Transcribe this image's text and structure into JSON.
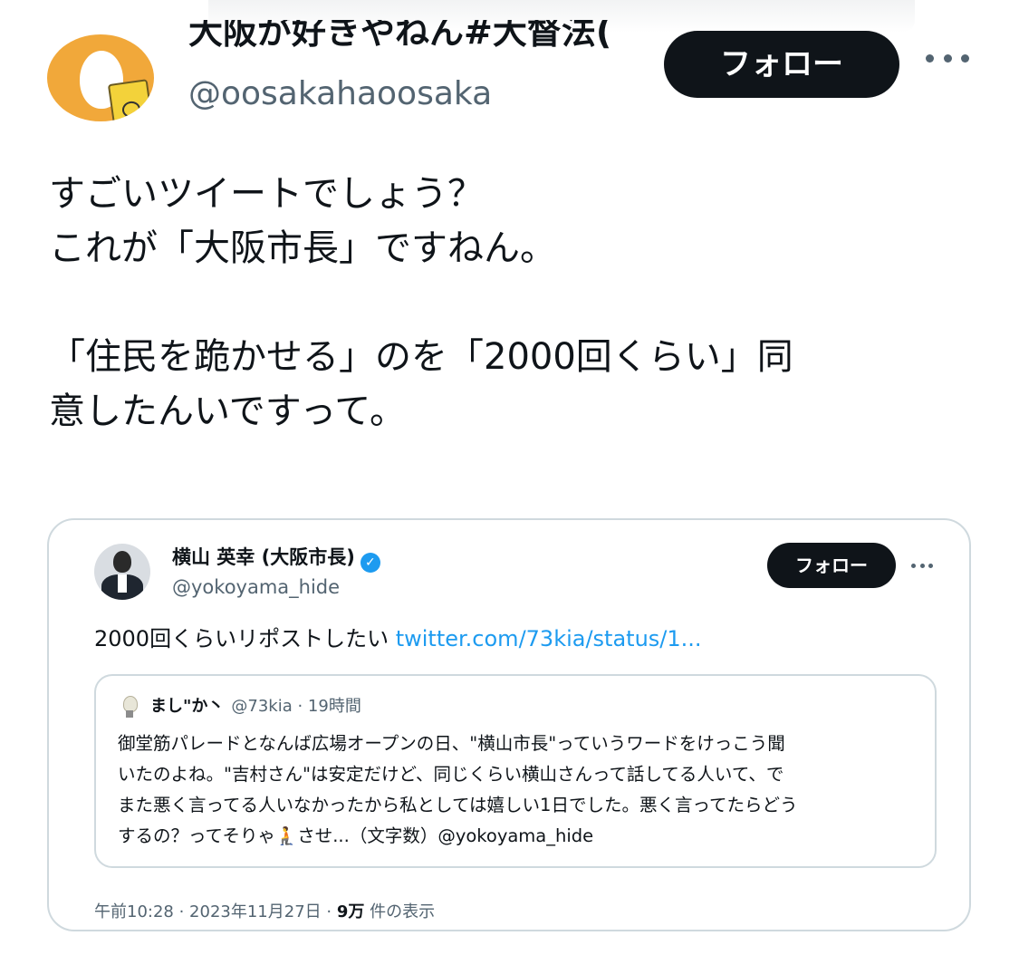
{
  "tweet": {
    "display_name": "大阪が好きやねん#大督法(",
    "handle": "@oosakahaoosaka",
    "follow_label": "フォロー",
    "text": "すごいツイートでしょう？\nこれが「大阪市長」ですねん。\n\n「住民を跪かせる」のを「2000回くらい」同\n意したんいですって。"
  },
  "embedded": {
    "name": "横山 英幸 (大阪市長)",
    "handle": "@yokoyama_hide",
    "follow_label": "フォロー",
    "text": "2000回くらいリポストしたい",
    "link": "twitter.com/73kia/status/1...",
    "quote": {
      "name": "まし\"か丶",
      "meta": "@73kia · 19時間",
      "text": "御堂筋パレードとなんば広場オープンの日、\"横山市長\"っていうワードをけっこう聞\nいたのよね。\"吉村さん\"は安定だけど、同じくらい横山さんって話してる人いて、で\nまた悪く言ってる人いなかったから私としては嬉しい1日でした。悪く言ってたらどう\nするの？ってそりゃ🧎させ...（文字数）@yokoyama_hide"
    },
    "footer": {
      "time": "午前10:28 · 2023年11月27日 · ",
      "views": "9万",
      "views_label": " 件の表示"
    }
  },
  "colors": {
    "text": "#0f1419",
    "secondary": "#536471",
    "link": "#1d9bf0",
    "border": "#cfd9de",
    "avatar_bg": "#f1a83a"
  },
  "icons": [
    "more-icon",
    "verified-icon"
  ]
}
